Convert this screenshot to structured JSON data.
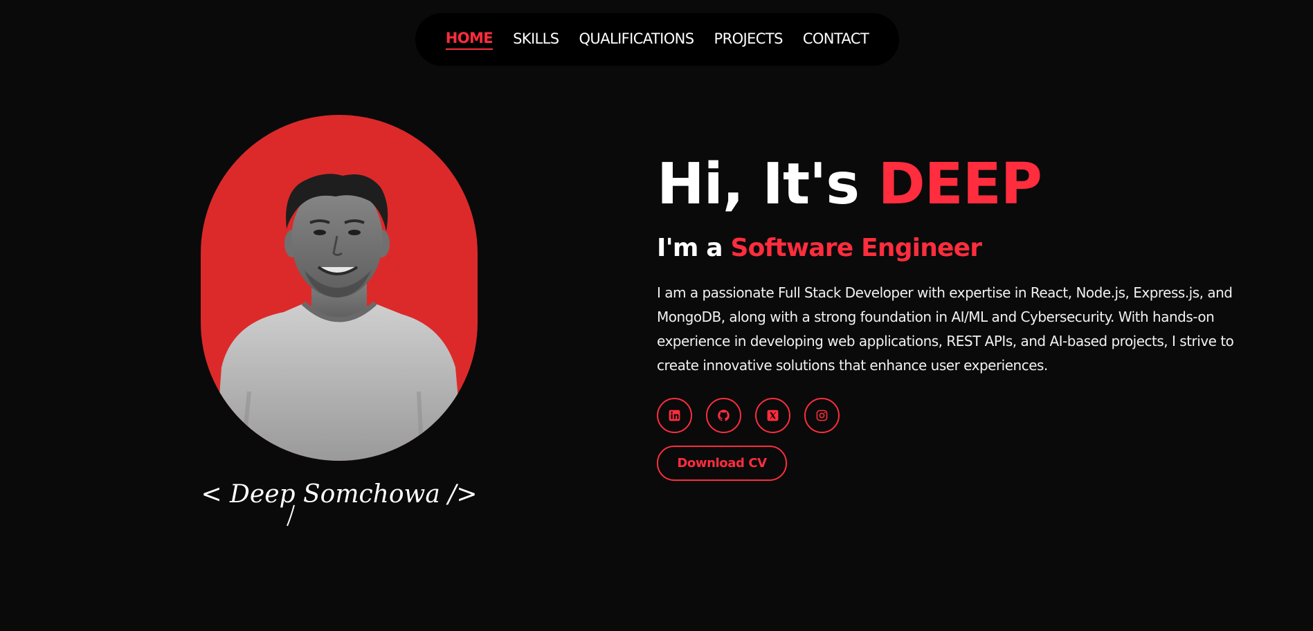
{
  "nav": {
    "items": [
      {
        "label": "HOME",
        "active": true
      },
      {
        "label": "SKILLS",
        "active": false
      },
      {
        "label": "QUALIFICATIONS",
        "active": false
      },
      {
        "label": "PROJECTS",
        "active": false
      },
      {
        "label": "CONTACT",
        "active": false
      }
    ]
  },
  "profile": {
    "photo_background": "#dc2a2a",
    "signature": "< Deep Somchowa />"
  },
  "hero": {
    "greeting": "Hi, It's ",
    "name": "DEEP",
    "role_prefix": "I'm a ",
    "role": "Software Engineer",
    "description": "I am a passionate Full Stack Developer with expertise in React, Node.js, Express.js, and MongoDB, along with a strong foundation in AI/ML and Cybersecurity. With hands-on experience in developing web applications, REST APIs, and AI-based projects, I strive to create innovative solutions that enhance user experiences."
  },
  "socials": [
    {
      "name": "linkedin-icon"
    },
    {
      "name": "github-icon"
    },
    {
      "name": "x-twitter-icon"
    },
    {
      "name": "instagram-icon"
    }
  ],
  "cv_button": {
    "label": "Download CV"
  },
  "colors": {
    "accent": "#ff2d3d",
    "background": "#0a0a0a",
    "nav_background": "#000000"
  }
}
